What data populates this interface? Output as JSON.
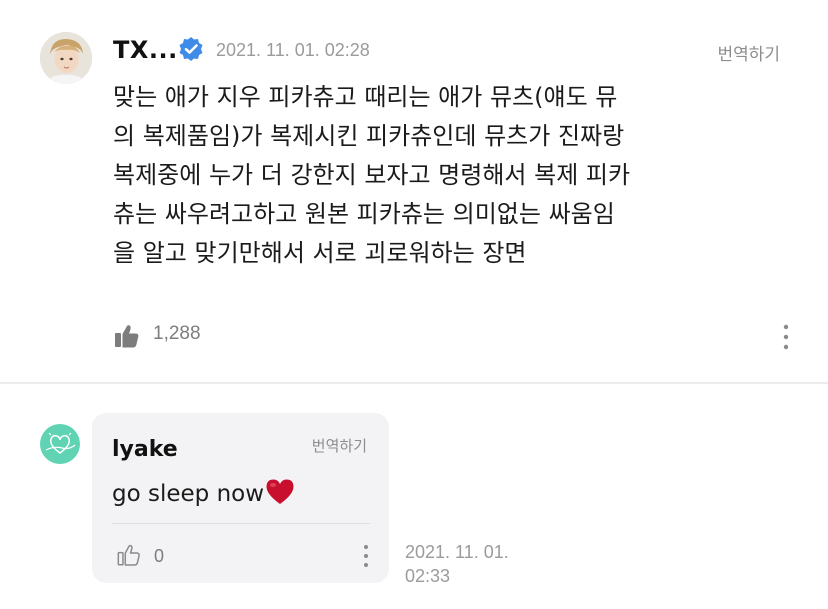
{
  "post": {
    "author": "TX...",
    "verified": true,
    "timestamp": "2021. 11. 01. 02:28",
    "translate_label": "번역하기",
    "body_lines": [
      "맞는 애가 지우 피카츄고 때리는 애가 뮤츠(얘도 뮤",
      "의 복제품임)가 복제시킨 피카츄인데 뮤츠가 진짜랑",
      "복제중에 누가 더 강한지 보자고 명령해서 복제 피카",
      "츄는 싸우려고하고 원본 피카츄는 의미없는 싸움임",
      "을 알고 맞기만해서 서로 괴로워하는 장면"
    ],
    "like_count": "1,288"
  },
  "comment": {
    "author": "lyake",
    "translate_label": "번역하기",
    "text": "go sleep now",
    "emoji": "heart-emoji",
    "like_count": "0",
    "timestamp_line1": "2021. 11. 01.",
    "timestamp_line2": "02:33"
  },
  "colors": {
    "verified_blue": "#3f8ce8",
    "muted_text": "#9b9b9b",
    "bubble_bg": "#f3f3f5",
    "comment_avatar_teal": "#5fd3b4",
    "heart_red": "#c8102e"
  }
}
